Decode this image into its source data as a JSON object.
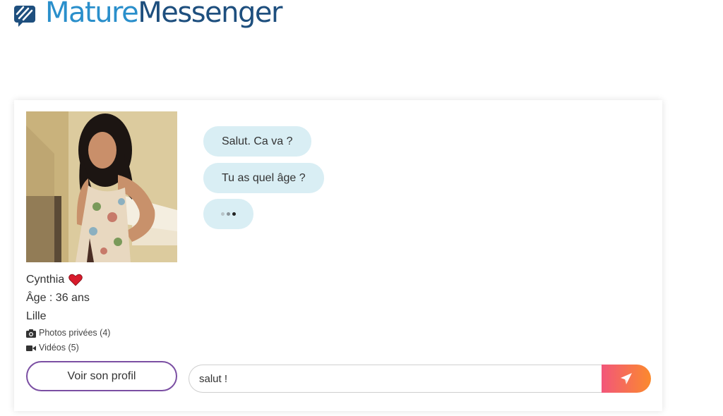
{
  "brand": {
    "part_1": "Mature",
    "part_2": "Messenger",
    "icon": "chat-bubble-logo-icon",
    "colors": {
      "light_blue": "#2a8fcb",
      "dark_blue": "#1e4f7e"
    }
  },
  "profile": {
    "name": "Cynthia",
    "status_icon": "heart-icon",
    "age_text": "Âge : 36 ans",
    "city": "Lille",
    "photos_label": "Photos privées (4)",
    "videos_label": "Vidéos (5)",
    "view_profile_label": "Voir son profil"
  },
  "chat": {
    "messages": [
      {
        "text": "Salut. Ca va ?"
      },
      {
        "text": "Tu as quel âge ?"
      }
    ],
    "typing_indicator": true,
    "bubble_color": "#d9eef4"
  },
  "composer": {
    "value": "salut !",
    "send_icon": "paper-plane-icon",
    "send_gradient": [
      "#f2567a",
      "#fb8a2d"
    ]
  },
  "colors": {
    "button_border": "#7b4fa3",
    "heart": "#d81b2c"
  }
}
